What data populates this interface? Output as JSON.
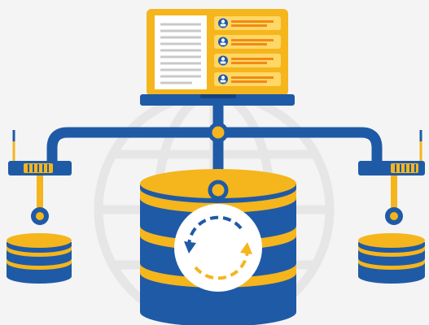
{
  "colors": {
    "background": "#f4f4f4",
    "blue": "#1f5aa6",
    "blue_dark": "#16437f",
    "yellow": "#f5b51c",
    "yellow_light": "#ffd766",
    "orange": "#f08a17",
    "white": "#ffffff",
    "globe": "#e6e6e6",
    "document_lines": "#c9c9c9"
  },
  "icons": {
    "laptop": "laptop-icon",
    "document": "document-icon",
    "user": "user-icon",
    "router": "router-icon",
    "antenna": "antenna-icon",
    "database": "database-icon",
    "globe": "globe-icon",
    "sync": "sync-icon"
  },
  "laptop": {
    "user_rows": 4
  }
}
